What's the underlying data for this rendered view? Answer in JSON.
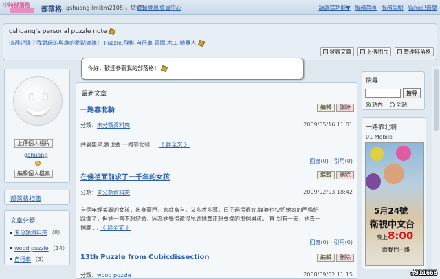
{
  "topbar": {
    "logo_text": "中時部落格",
    "site_title": "部落格",
    "greeting": "gshuang (mikm2105)，您好！",
    "logout": "會員登出",
    "member_center": "會員中心",
    "right_links": [
      "語選擇功能▼",
      "服務首頁",
      "服務說明",
      "Yahoo!奇摩"
    ]
  },
  "header": {
    "blog_title": "gshuang's personal puzzle note",
    "description": "這裡記錄了我對玩的與趣的點點滴滴！ Puzzle,飛棋,自行車 電腦,木工,機器人",
    "buttons": [
      "發表文章",
      "上傳相片",
      "管理部落格"
    ]
  },
  "bubble": {
    "text": "你好，歡迎參觀我的部落格！"
  },
  "profile": {
    "upload_photo": "上傳個人相片",
    "username": "gshuang",
    "edit_profile": "編輯個人檔案"
  },
  "photo_box": {
    "title": "部落格相簿"
  },
  "categories": {
    "title": "文章分類",
    "items": [
      {
        "name": "未分類資料夾",
        "count": "（8）"
      },
      {
        "name": "wood puzzle",
        "count": "（14）"
      },
      {
        "name": "自行車",
        "count": "（3）"
      }
    ]
  },
  "main": {
    "title": "最新文章",
    "edit_label": "編輯",
    "delete_label": "刪除",
    "category_prefix": "分類：",
    "reply_label": "回應",
    "reply_count": "(0)",
    "trackback_label": "引用",
    "trackback_count": "(0)",
    "posts": [
      {
        "title": "一路靠北騎",
        "category": "未分類資料夾",
        "date": "2009/05/16 11:01",
        "body": "共襄盛舉,我也要 一路靠北騎 ...",
        "more": "《 詳全文 》"
      },
      {
        "title": "在佛祖面前求了一千年的女孩",
        "category": "未分類資料夾",
        "date": "2009/02/03 18:42",
        "body_line1": "有個年輕美麗的女孩，出身豪門，家庭富有，又多才多藝，日子過得很好,媒婆也快把她家的門檻給",
        "body_line2": "踩爛了，但她一直不想結婚，因為她覺得還沒見到她真正想要嫁的那個男孩。 直 到有一天，她去一",
        "body_line3": "個廟 ...",
        "more": "《 詳全文 》"
      },
      {
        "title": "13th Puzzle from Cubicdissection",
        "category": "wood puzzle",
        "date": "2008/09/02 11:15"
      }
    ]
  },
  "search": {
    "title": "搜尋",
    "placeholder": "",
    "button": "搜尋",
    "option_site": "站內",
    "option_web": "全站"
  },
  "featured": {
    "title": "一路靠北騎",
    "subtitle": "01 Mobile",
    "day": "5月24號",
    "channel": "衛視中文台",
    "time_prefix": "晚上",
    "time": "8:00",
    "tagline": "跟我們一路"
  },
  "watermark": "#911668"
}
